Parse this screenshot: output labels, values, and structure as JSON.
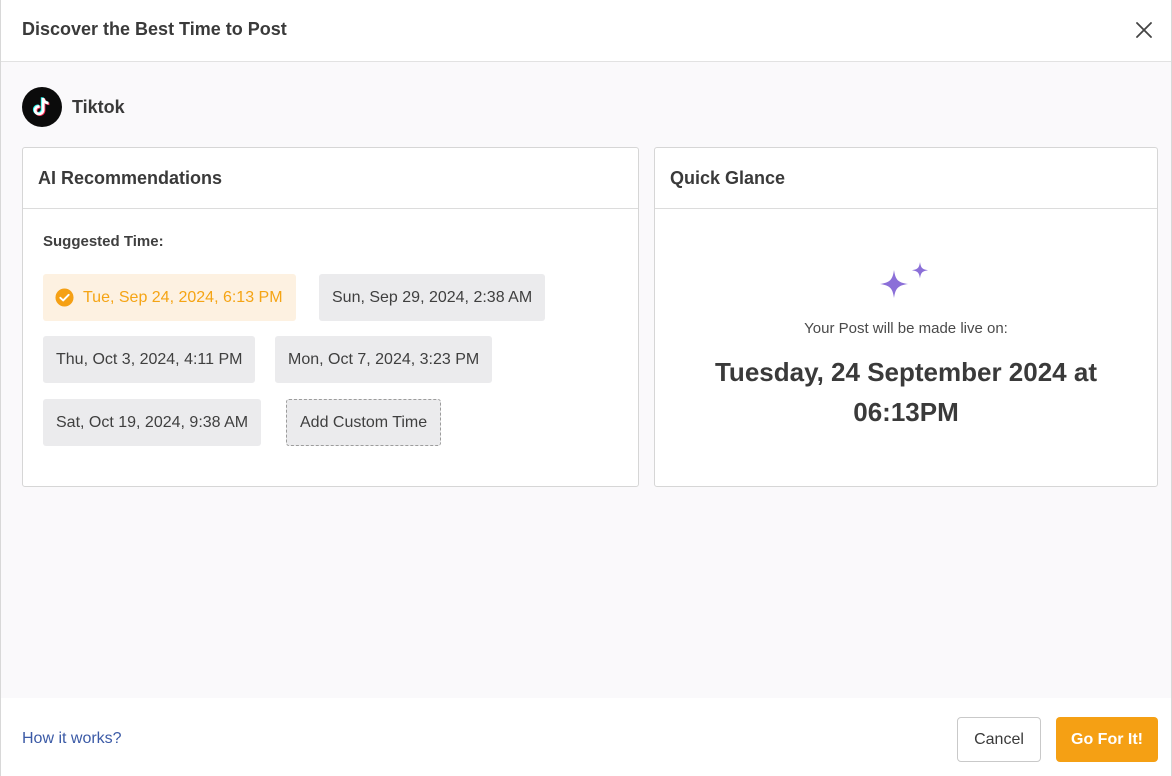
{
  "dialog": {
    "title": "Discover the Best Time to Post"
  },
  "platform": {
    "name": "Tiktok",
    "icon": "tiktok-icon"
  },
  "ai_recommendations": {
    "heading": "AI Recommendations",
    "suggested_label": "Suggested Time:",
    "times": [
      {
        "label": "Tue, Sep 24, 2024, 6:13 PM",
        "selected": true
      },
      {
        "label": "Sun, Sep 29, 2024, 2:38 AM",
        "selected": false
      },
      {
        "label": "Thu, Oct 3, 2024, 4:11 PM",
        "selected": false
      },
      {
        "label": "Mon, Oct 7, 2024, 3:23 PM",
        "selected": false
      },
      {
        "label": "Sat, Oct 19, 2024, 9:38 AM",
        "selected": false
      }
    ],
    "custom_label": "Add Custom Time"
  },
  "quick_glance": {
    "heading": "Quick Glance",
    "live_label": "Your Post will be made live on:",
    "live_date": "Tuesday, 24 September 2024 at 06:13PM",
    "icon": "sparkle-icon",
    "icon_color": "#8b6fd8"
  },
  "footer": {
    "how_link": "How it works?",
    "cancel_label": "Cancel",
    "go_label": "Go For It!"
  },
  "colors": {
    "accent": "#f5a014",
    "link": "#3b5aa6"
  }
}
